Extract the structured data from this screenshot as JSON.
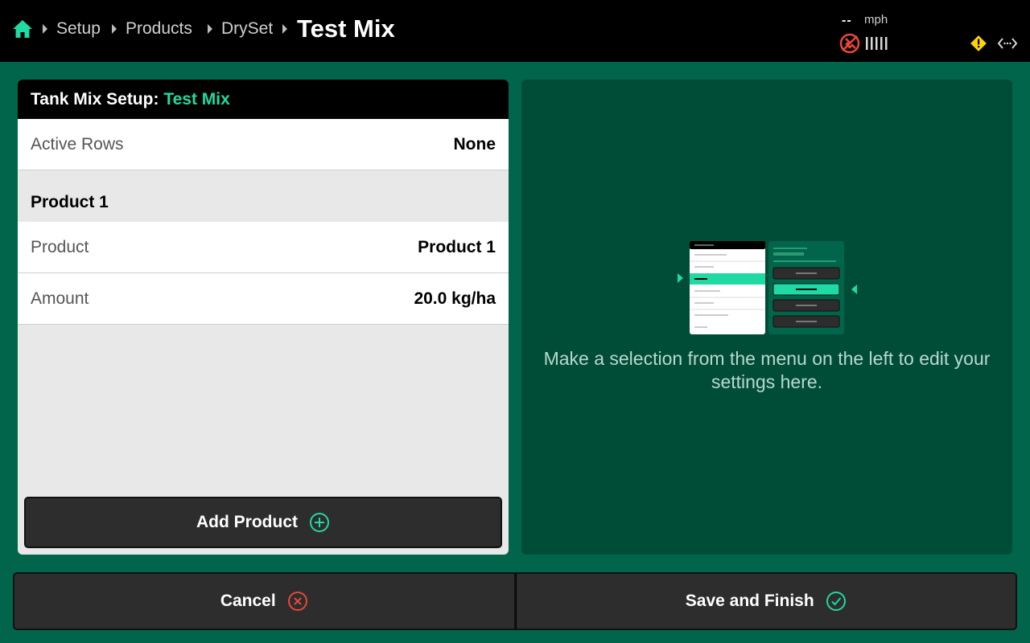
{
  "header": {
    "home_icon": "home-icon",
    "breadcrumbs": [
      "Setup",
      "Products",
      "DrySet"
    ],
    "current": "Test Mix",
    "speed_value": "--",
    "speed_unit": "mph",
    "gps_icon": "gps-signal-lost-icon",
    "signal_icon": "signal-bars-icon",
    "warning_icon": "warning-icon",
    "connection_icon": "connection-icon"
  },
  "left_panel": {
    "title_prefix": "Tank Mix Setup:",
    "title_name": "Test Mix",
    "active_rows_label": "Active Rows",
    "active_rows_value": "None",
    "section_title": "Product 1",
    "rows": [
      {
        "label": "Product",
        "value": "Product 1"
      },
      {
        "label": "Amount",
        "value": "20.0 kg/ha"
      }
    ],
    "add_button_label": "Add Product"
  },
  "right_panel": {
    "message": "Make a selection from the menu on the left to edit your settings here."
  },
  "footer": {
    "cancel_label": "Cancel",
    "save_label": "Save and Finish"
  },
  "colors": {
    "background": "#00654a",
    "panel_dark": "#004d37",
    "accent": "#1fdaa2",
    "cancel_icon": "#e8483a",
    "warning": "#ffd400"
  }
}
